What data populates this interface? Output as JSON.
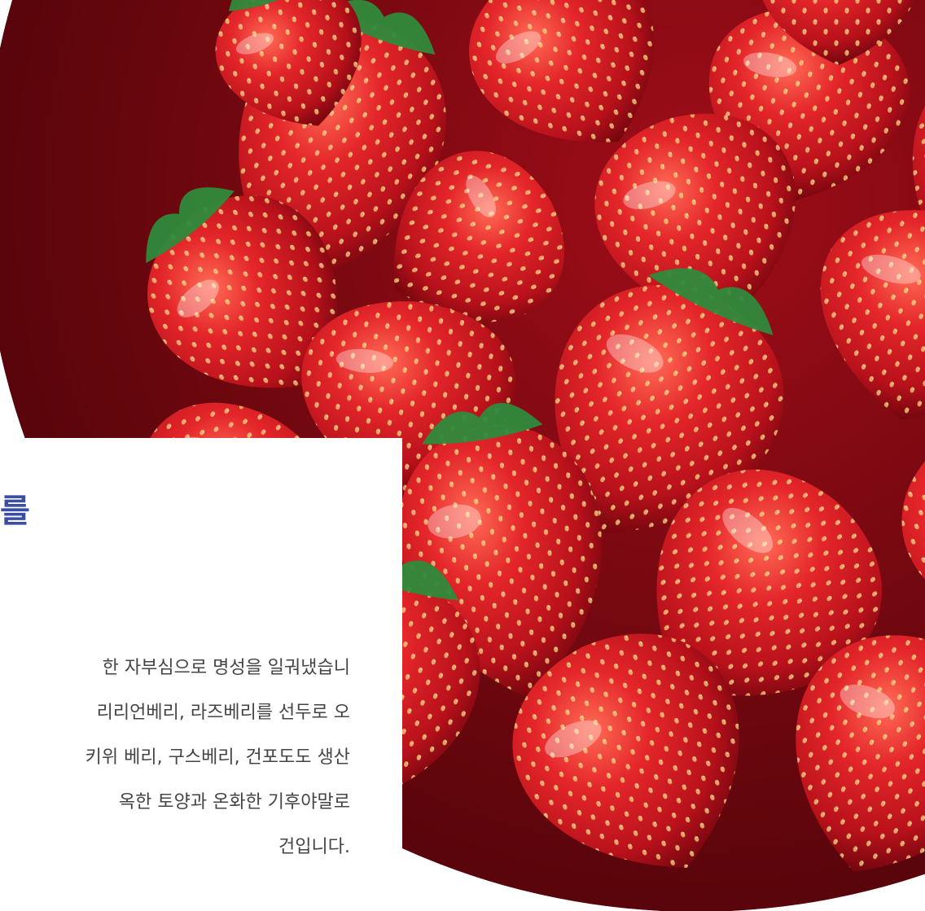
{
  "colors": {
    "title": "#3a4fa3",
    "body_text": "#444444",
    "berry_dark": "#8e0a14",
    "berry": "#d61c24",
    "berry_light": "#f0453a",
    "seed": "#f3d27a",
    "leaf": "#2f8a3c"
  },
  "hero_image": {
    "subject": "strawberries"
  },
  "card": {
    "title": "를",
    "body_lines": [
      "한 자부심으로 명성을 일궈냈습니",
      "리리언베리, 라즈베리를 선두로 오",
      "키위 베리, 구스베리, 건포도도 생산",
      "옥한 토양과 온화한 기후야말로",
      "건입니다."
    ]
  }
}
